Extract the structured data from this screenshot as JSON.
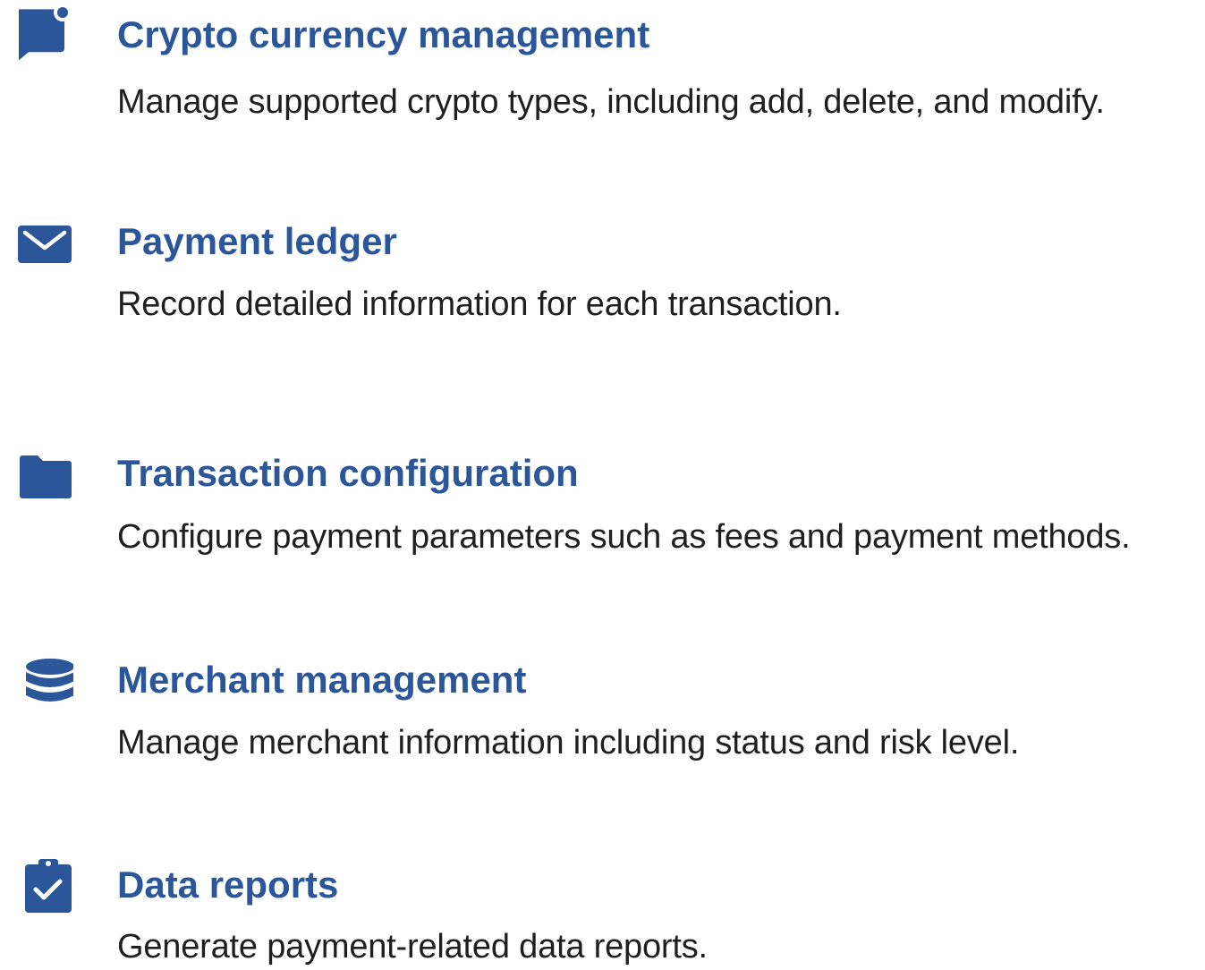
{
  "accent_color": "#2b579a",
  "text_color": "#1f1f1f",
  "features": [
    {
      "icon": "chat-bubble-icon",
      "title": "Crypto currency management",
      "description": "Manage supported crypto types, including add, delete, and modify."
    },
    {
      "icon": "envelope-icon",
      "title": "Payment ledger",
      "description": "Record detailed information for each transaction."
    },
    {
      "icon": "folder-icon",
      "title": "Transaction configuration",
      "description": "Configure payment parameters such as fees and payment methods."
    },
    {
      "icon": "database-icon",
      "title": "Merchant management",
      "description": "Manage merchant information including status and risk level."
    },
    {
      "icon": "clipboard-check-icon",
      "title": "Data reports",
      "description": "Generate payment-related data reports."
    }
  ]
}
